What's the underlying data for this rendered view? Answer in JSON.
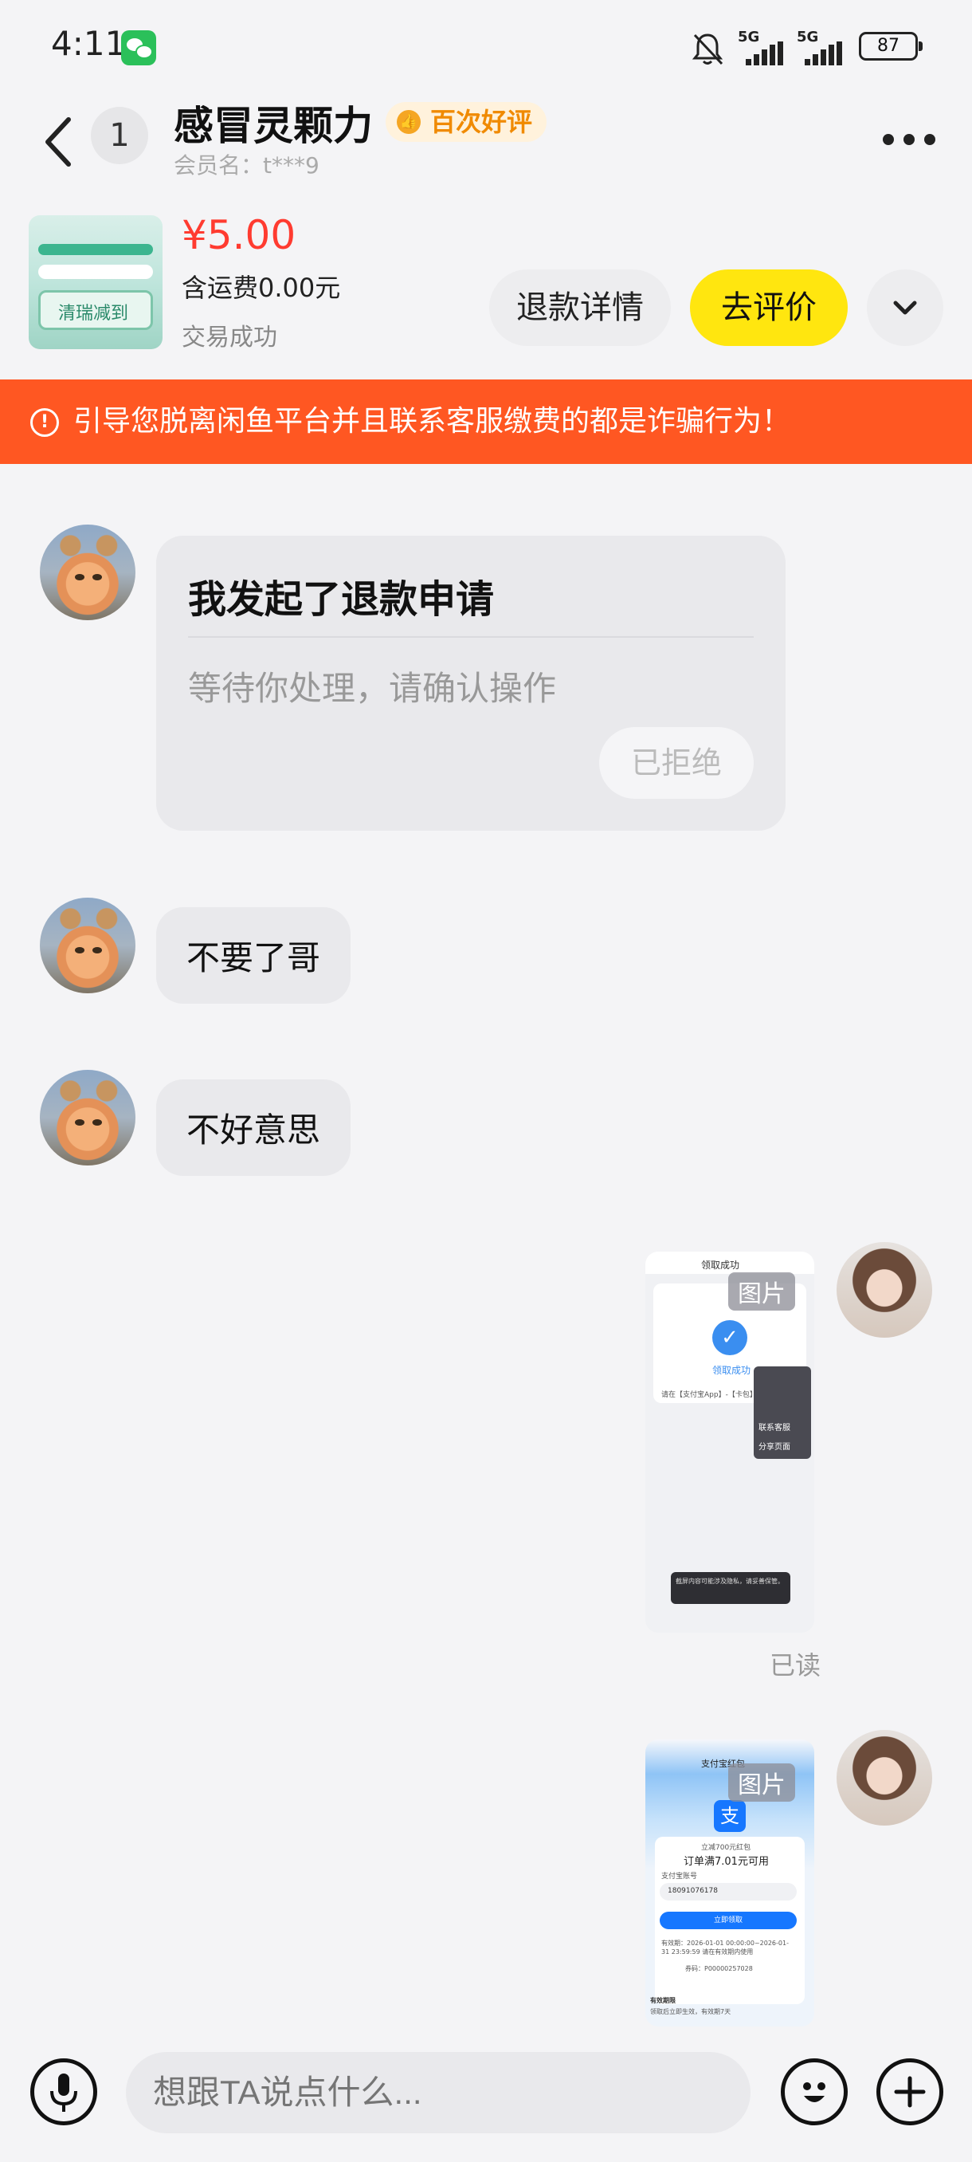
{
  "status_bar": {
    "time": "4:11",
    "network1": "5G",
    "network2": "5G",
    "battery": "87"
  },
  "header": {
    "unread_count": "1",
    "title": "感冒灵颗力",
    "tag": "百次好评",
    "member": "会员名：t***9"
  },
  "product": {
    "price": "¥5.00",
    "shipping": "含运费0.00元",
    "status": "交易成功",
    "thumb_text": "清瑞减到",
    "refund_button": "退款详情",
    "review_button": "去评价"
  },
  "warning": {
    "text": "引导您脱离闲鱼平台并且联系客服缴费的都是诈骗行为！"
  },
  "messages": {
    "refund_card": {
      "title": "我发起了退款申请",
      "subtitle": "等待你处理，请确认操作",
      "button": "已拒绝"
    },
    "msg1": "不要了哥",
    "msg2": "不好意思",
    "image_label": "图片",
    "read_status": "已读",
    "shot1": {
      "header": "领取成功",
      "success": "领取成功",
      "body": "请在【支付宝App】-【卡包】-",
      "service": "联系客服",
      "share": "分享页面",
      "toast": "截屏内容可能涉及隐私，请妥善保管。"
    },
    "shot2": {
      "header": "支付宝红包",
      "amount": "立减700元红包",
      "condition": "订单满7.01元可用",
      "account_label": "支付宝账号",
      "account_value": "18091076178",
      "button": "立即领取",
      "validity": "有效期：2026-01-01 00:00:00~2026-01-31 23:59:59 请在有效期内使用",
      "code": "券码：P00000257028",
      "footer1": "有效期限",
      "footer2": "领取后立即生效，有效期7天"
    }
  },
  "composer": {
    "placeholder": "想跟TA说点什么..."
  },
  "colors": {
    "accent": "#ffe60f",
    "price": "#ff3b30",
    "warning": "#ff5722"
  }
}
